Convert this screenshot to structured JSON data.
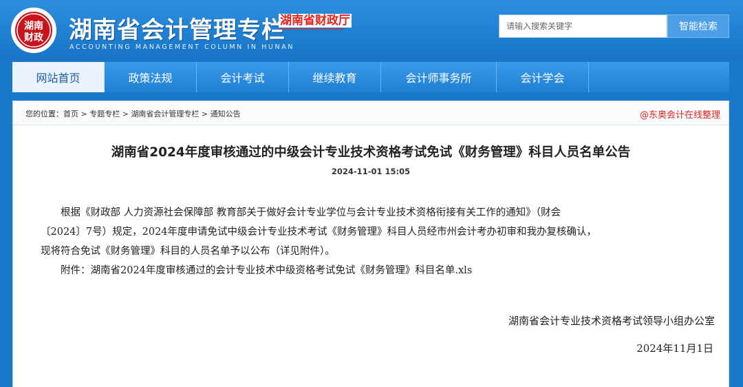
{
  "header": {
    "site_title": "湖南省会计管理专栏",
    "site_subtitle": "ACCOUNTING MANAGEMENT COLUMN IN HUNAN",
    "brand_name": "湖南省财政厅",
    "seal_text": "湖南财政",
    "search_placeholder": "请输入搜索关键字",
    "search_button": "智能检索"
  },
  "nav": {
    "items": [
      {
        "label": "网站首页",
        "active": true
      },
      {
        "label": "政策法规"
      },
      {
        "label": "会计考试"
      },
      {
        "label": "继续教育"
      },
      {
        "label": "会计师事务所"
      },
      {
        "label": "会计学会"
      }
    ]
  },
  "breadcrumb": {
    "prefix": "您的位置：",
    "items": [
      "首页",
      "专题专栏",
      "湖南省会计管理专栏",
      "通知公告"
    ],
    "separator": " > "
  },
  "watermark": "@东奥会计在线整理",
  "article": {
    "title": "湖南省2024年度审核通过的中级会计专业技术资格考试免试《财务管理》科目人员名单公告",
    "date": "2024-11-01 15:05",
    "paragraphs": [
      "　　根据《财政部 人力资源社会保障部 教育部关于做好会计专业学位与会计专业技术资格衔接有关工作的通知》（财会",
      "〔2024〕7号）规定，2024年度申请免试中级会计专业技术考试《财务管理》科目人员经市州会计考办初审和我办复核确认，",
      "现将符合免试《财务管理》科目的人员名单予以公布（详见附件）。",
      "　　附件：湖南省2024年度审核通过的会计专业技术中级资格考试免试《财务管理》科目名单.xls"
    ],
    "sign_org": "湖南省会计专业技术资格考试领导小组办公室",
    "sign_date": "2024年11月1日"
  }
}
